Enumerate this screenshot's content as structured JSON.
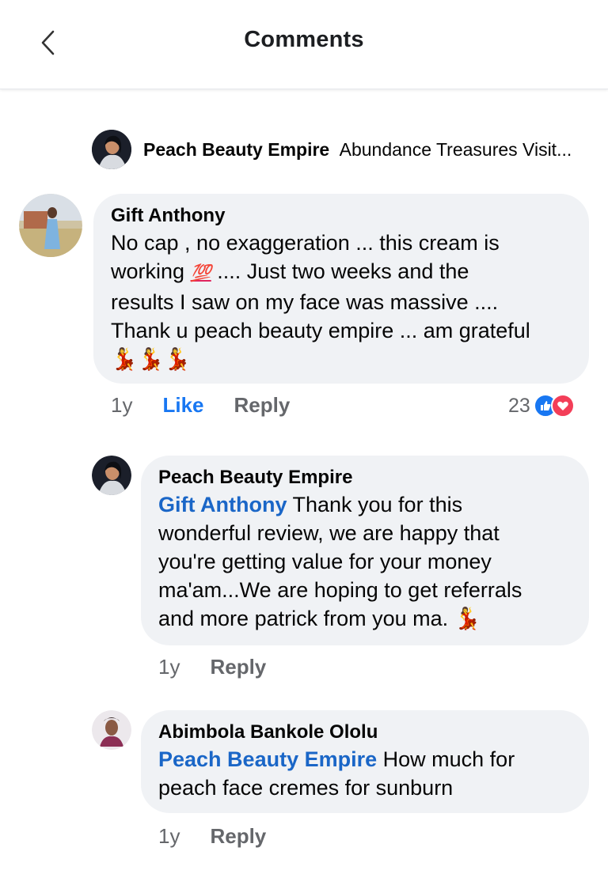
{
  "header": {
    "title": "Comments"
  },
  "preview": {
    "author": "Peach Beauty Empire",
    "snippet": "Abundance Treasures Visit..."
  },
  "comments": [
    {
      "author": "Gift Anthony",
      "lines": [
        "No cap , no exaggeration ... this cream is",
        "working",
        ".... Just two weeks and the",
        "results I saw on my face was massive ....",
        "Thank u peach beauty empire ... am grateful"
      ],
      "emoji_100": "💯",
      "dancers": "💃💃💃",
      "time": "1y",
      "like_label": "Like",
      "reply_label": "Reply",
      "reaction_count": "23",
      "colors": {
        "like": "#1877f2",
        "love": "#f33e58"
      }
    },
    {
      "author": "Peach Beauty Empire",
      "mention": "Gift Anthony",
      "lines": [
        "Thank you for this",
        "wonderful review,  we are happy that",
        "you're getting value for your money",
        "ma'am...We are hoping to get referrals",
        "and more patrick from you ma."
      ],
      "dancer": "💃",
      "time": "1y",
      "reply_label": "Reply"
    },
    {
      "author": "Abimbola Bankole Ololu",
      "mention": "Peach Beauty Empire",
      "lines": [
        "How much for",
        "peach face cremes for sunburn"
      ],
      "time": "1y",
      "reply_label": "Reply"
    }
  ]
}
